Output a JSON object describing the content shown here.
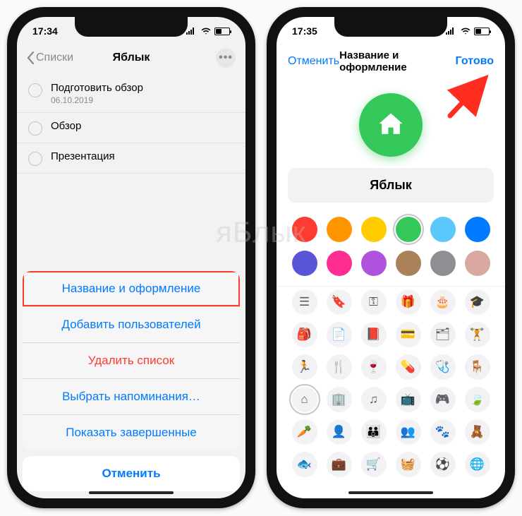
{
  "watermark": "яБлык",
  "left": {
    "status_time": "17:34",
    "back_label": "Списки",
    "title": "Яблык",
    "reminders": [
      {
        "title": "Подготовить обзор",
        "sub": "06.10.2019"
      },
      {
        "title": "Обзор",
        "sub": ""
      },
      {
        "title": "Презентация",
        "sub": ""
      }
    ],
    "sheet": {
      "name_appearance": "Название и оформление",
      "add_people": "Добавить пользователей",
      "delete_list": "Удалить список",
      "select_reminders": "Выбрать напоминания…",
      "show_completed": "Показать завершенные",
      "cancel": "Отменить"
    }
  },
  "right": {
    "status_time": "17:35",
    "cancel": "Отменить",
    "title": "Название и оформление",
    "done": "Готово",
    "list_name": "Яблык",
    "selected_icon": "home-icon",
    "colors": [
      {
        "name": "red",
        "hex": "#ff3b30",
        "selected": false
      },
      {
        "name": "orange",
        "hex": "#ff9500",
        "selected": false
      },
      {
        "name": "yellow",
        "hex": "#ffcc00",
        "selected": false
      },
      {
        "name": "green",
        "hex": "#34c759",
        "selected": true
      },
      {
        "name": "lightblue",
        "hex": "#5ac8fa",
        "selected": false
      },
      {
        "name": "blue",
        "hex": "#007aff",
        "selected": false
      },
      {
        "name": "indigo",
        "hex": "#5856d6",
        "selected": false
      },
      {
        "name": "pink",
        "hex": "#ff2d92",
        "selected": false
      },
      {
        "name": "purple",
        "hex": "#af52de",
        "selected": false
      },
      {
        "name": "brown",
        "hex": "#a98259",
        "selected": false
      },
      {
        "name": "gray",
        "hex": "#8e8e93",
        "selected": false
      },
      {
        "name": "rose",
        "hex": "#d9a8a0",
        "selected": false
      }
    ],
    "icons": [
      "list-icon",
      "bookmark-icon",
      "key-icon",
      "gift-icon",
      "cake-icon",
      "graduation-icon",
      "backpack-icon",
      "document-icon",
      "book-icon",
      "card-icon",
      "pills-stack-icon",
      "dumbbell-icon",
      "running-icon",
      "utensils-icon",
      "wine-icon",
      "pill-icon",
      "stethoscope-icon",
      "chair-icon",
      "home-icon",
      "building-icon",
      "music-icon",
      "tv-icon",
      "gamepad-icon",
      "leaf-icon",
      "carrot-icon",
      "person-icon",
      "family-icon",
      "group-icon",
      "paw-icon",
      "teddy-icon",
      "fish-icon",
      "briefcase-icon",
      "cart-icon",
      "basket-icon",
      "soccer-icon",
      "globe-icon"
    ],
    "icon_glyphs": {
      "list-icon": "☰",
      "bookmark-icon": "🔖",
      "key-icon": "⚿",
      "gift-icon": "🎁",
      "cake-icon": "🎂",
      "graduation-icon": "🎓",
      "backpack-icon": "🎒",
      "document-icon": "📄",
      "book-icon": "📕",
      "card-icon": "💳",
      "pills-stack-icon": "🗂",
      "dumbbell-icon": "🏋",
      "running-icon": "🏃",
      "utensils-icon": "🍴",
      "wine-icon": "🍷",
      "pill-icon": "💊",
      "stethoscope-icon": "🩺",
      "chair-icon": "🪑",
      "home-icon": "⌂",
      "building-icon": "🏢",
      "music-icon": "♫",
      "tv-icon": "📺",
      "gamepad-icon": "🎮",
      "leaf-icon": "🍃",
      "carrot-icon": "🥕",
      "person-icon": "👤",
      "family-icon": "👪",
      "group-icon": "👥",
      "paw-icon": "🐾",
      "teddy-icon": "🧸",
      "fish-icon": "🐟",
      "briefcase-icon": "💼",
      "cart-icon": "🛒",
      "basket-icon": "🧺",
      "soccer-icon": "⚽",
      "globe-icon": "🌐"
    }
  }
}
